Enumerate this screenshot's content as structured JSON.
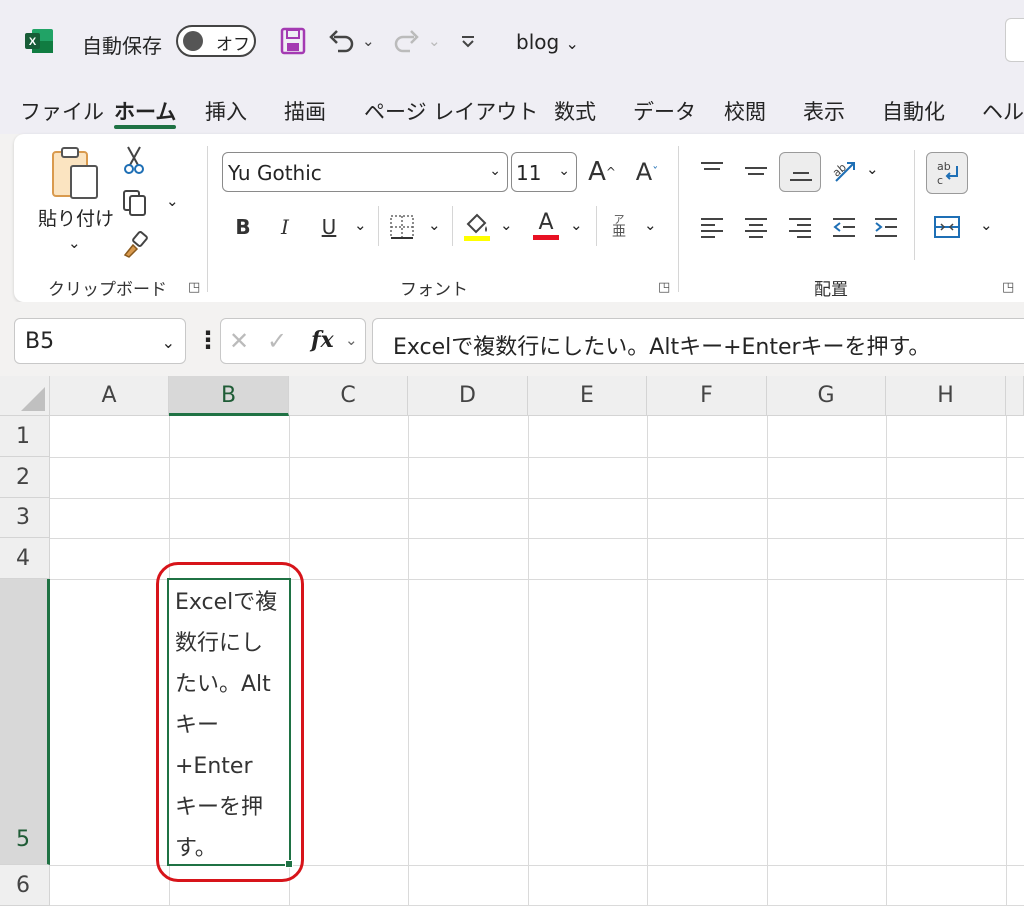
{
  "titlebar": {
    "autosave_label": "自動保存",
    "autosave_state": "オフ",
    "filename": "blog"
  },
  "menu": {
    "tabs": [
      "ファイル",
      "ホーム",
      "挿入",
      "描画",
      "ページ レイアウト",
      "数式",
      "データ",
      "校閲",
      "表示",
      "自動化",
      "ヘルプ"
    ],
    "active_tab": "ホーム"
  },
  "ribbon": {
    "clipboard": {
      "paste_label": "貼り付け",
      "group_label": "クリップボード"
    },
    "font": {
      "font_name": "Yu Gothic",
      "font_size": "11",
      "group_label": "フォント",
      "bold": "B",
      "italic": "I",
      "underline": "U",
      "grow": "A",
      "shrink": "A",
      "color_letter": "A",
      "phonetic_top": "ア",
      "phonetic_bottom": "亜",
      "fill_color": "#ffff00",
      "font_color": "#e81123"
    },
    "alignment": {
      "group_label": "配置",
      "wrap_text": "ab c"
    }
  },
  "formula_bar": {
    "name_box": "B5",
    "fx": "fx",
    "content": "Excelで複数行にしたい。Altキー+Enterキーを押す。"
  },
  "grid": {
    "columns": [
      "A",
      "B",
      "C",
      "D",
      "E",
      "F",
      "G",
      "H"
    ],
    "selected_column": "B",
    "rows": [
      "1",
      "2",
      "3",
      "4",
      "5",
      "6"
    ],
    "selected_row": "5",
    "active_cell_text": "Excelで複\n数行にし\nたい。Alt\nキー\n+Enter\nキーを押\nす。"
  },
  "colors": {
    "accent": "#1f7244",
    "highlight": "#d7141a"
  }
}
